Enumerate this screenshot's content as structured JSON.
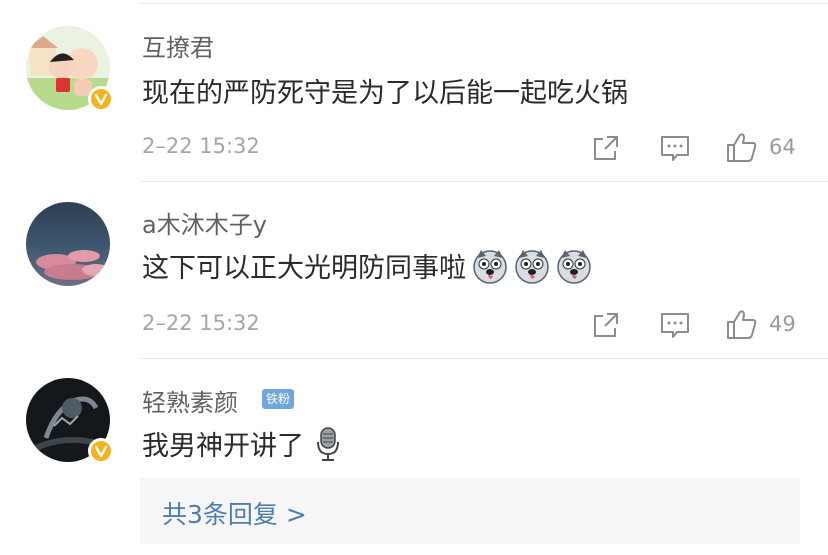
{
  "comments": [
    {
      "username": "互撩君",
      "content": "现在的严防死守是为了以后能一起吃火锅",
      "time": "2–22 15:32",
      "like_count": "64",
      "verified": true,
      "emojis": []
    },
    {
      "username": "a木沐木子y",
      "content": "这下可以正大光明防同事啦",
      "time": "2–22 15:32",
      "like_count": "49",
      "verified": false,
      "emojis": [
        "husky-dog-emoji",
        "husky-dog-emoji",
        "husky-dog-emoji"
      ]
    },
    {
      "username": "轻熟素颜",
      "badge": "铁粉",
      "content": "我男神开讲了",
      "verified": true,
      "emojis": [
        "microphone-emoji"
      ]
    }
  ],
  "replies_link": "共3条回复 >",
  "icons": {
    "share": "share-icon",
    "comment": "comment-icon",
    "like": "thumbs-up-icon",
    "verified": "verified-v-icon"
  },
  "colors": {
    "link_blue": "#4e7eaf",
    "verified_gold": "#f6b21b",
    "fan_badge": "#6fa7dc"
  }
}
